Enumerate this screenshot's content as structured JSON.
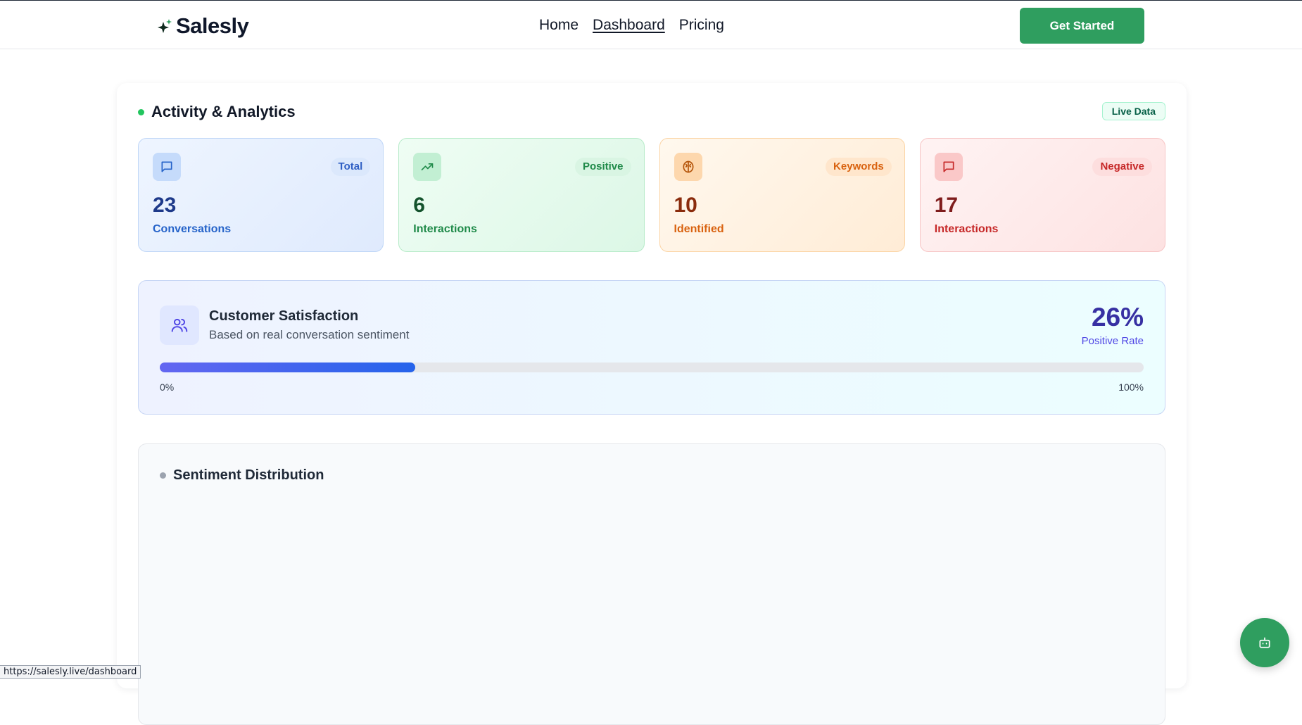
{
  "brand": {
    "name": "Salesly"
  },
  "nav": {
    "items": [
      "Home",
      "Dashboard",
      "Pricing"
    ],
    "active": "Dashboard"
  },
  "header": {
    "cta_label": "Get Started"
  },
  "analytics": {
    "title": "Activity & Analytics",
    "badge": "Live Data",
    "stats": [
      {
        "tag": "Total",
        "value": "23",
        "label": "Conversations",
        "icon": "message-icon"
      },
      {
        "tag": "Positive",
        "value": "6",
        "label": "Interactions",
        "icon": "trending-up-icon"
      },
      {
        "tag": "Keywords",
        "value": "10",
        "label": "Identified",
        "icon": "brain-icon"
      },
      {
        "tag": "Negative",
        "value": "17",
        "label": "Interactions",
        "icon": "message-icon"
      }
    ]
  },
  "satisfaction": {
    "title": "Customer Satisfaction",
    "subtitle": "Based on real conversation sentiment",
    "percent_text": "26%",
    "percent_value": 26,
    "rate_label": "Positive Rate",
    "min_label": "0%",
    "max_label": "100%",
    "icon": "users-icon"
  },
  "distribution": {
    "title": "Sentiment Distribution"
  },
  "chat_fab": {
    "icon": "bot-icon"
  },
  "status_bar": {
    "url": "https://salesly.live/dashboard"
  },
  "colors": {
    "brand_green": "#2f9e5f",
    "indicator_green": "#22c55e",
    "progress_start": "#6366f1",
    "progress_end": "#2563eb"
  }
}
